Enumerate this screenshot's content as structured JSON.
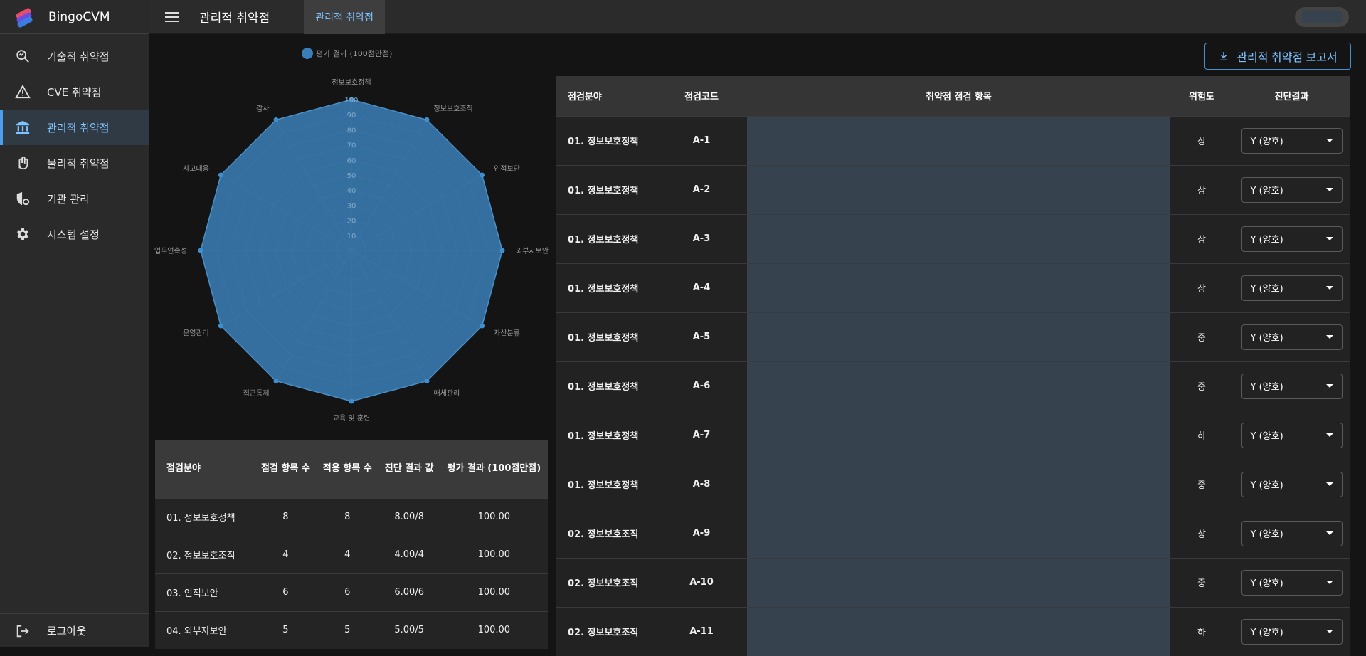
{
  "app": {
    "name": "BingoCVM"
  },
  "sidebar": {
    "items": [
      {
        "label": "기술적 취약점",
        "icon": "search-analytics-icon"
      },
      {
        "label": "CVE 취약점",
        "icon": "warning-icon"
      },
      {
        "label": "관리적 취약점",
        "icon": "bank-icon"
      },
      {
        "label": "물리적 취약점",
        "icon": "hand-icon"
      },
      {
        "label": "기관 관리",
        "icon": "shield-settings-icon"
      },
      {
        "label": "시스템 설정",
        "icon": "gear-icon"
      }
    ],
    "active_index": 2,
    "logout_label": "로그아웃"
  },
  "header": {
    "title": "관리적 취약점",
    "tab": "관리적 취약점"
  },
  "report_button": {
    "label": "관리적 취약점 보고서"
  },
  "chart_data": {
    "type": "radar",
    "legend": "평가 결과 (100점만점)",
    "categories": [
      "정보보호정책",
      "정보보호조직",
      "인적보안",
      "외부자보안",
      "자산분류",
      "매체관리",
      "교육 및 훈련",
      "접근통제",
      "운영관리",
      "업무연속성",
      "사고대응",
      "감사"
    ],
    "values": [
      100,
      100,
      100,
      100,
      100,
      100,
      100,
      100,
      100,
      100,
      100,
      100
    ],
    "ticks": [
      "10",
      "20",
      "30",
      "40",
      "50",
      "60",
      "70",
      "80",
      "90",
      "100"
    ],
    "range": [
      0,
      100
    ],
    "color": "#3a7fb8"
  },
  "summary": {
    "headers": [
      "점검분야",
      "점검 항목 수",
      "적용 항목 수",
      "진단 결과 값",
      "평가 결과 (100점만점)"
    ],
    "rows": [
      [
        "01. 정보보호정책",
        "8",
        "8",
        "8.00/8",
        "100.00"
      ],
      [
        "02. 정보보호조직",
        "4",
        "4",
        "4.00/4",
        "100.00"
      ],
      [
        "03. 인적보안",
        "6",
        "6",
        "6.00/6",
        "100.00"
      ],
      [
        "04. 외부자보안",
        "5",
        "5",
        "5.00/5",
        "100.00"
      ]
    ]
  },
  "main_table": {
    "headers": [
      "점검분야",
      "점검코드",
      "취약점 점검 항목",
      "위험도",
      "진단결과"
    ],
    "rows": [
      {
        "category": "01. 정보보호정책",
        "code": "A-1",
        "risk": "상",
        "result": "Y (양호)"
      },
      {
        "category": "01. 정보보호정책",
        "code": "A-2",
        "risk": "상",
        "result": "Y (양호)"
      },
      {
        "category": "01. 정보보호정책",
        "code": "A-3",
        "risk": "상",
        "result": "Y (양호)"
      },
      {
        "category": "01. 정보보호정책",
        "code": "A-4",
        "risk": "상",
        "result": "Y (양호)"
      },
      {
        "category": "01. 정보보호정책",
        "code": "A-5",
        "risk": "중",
        "result": "Y (양호)"
      },
      {
        "category": "01. 정보보호정책",
        "code": "A-6",
        "risk": "중",
        "result": "Y (양호)"
      },
      {
        "category": "01. 정보보호정책",
        "code": "A-7",
        "risk": "하",
        "result": "Y (양호)"
      },
      {
        "category": "01. 정보보호정책",
        "code": "A-8",
        "risk": "중",
        "result": "Y (양호)"
      },
      {
        "category": "02. 정보보호조직",
        "code": "A-9",
        "risk": "상",
        "result": "Y (양호)"
      },
      {
        "category": "02. 정보보호조직",
        "code": "A-10",
        "risk": "중",
        "result": "Y (양호)"
      },
      {
        "category": "02. 정보보호조직",
        "code": "A-11",
        "risk": "하",
        "result": "Y (양호)"
      }
    ]
  }
}
